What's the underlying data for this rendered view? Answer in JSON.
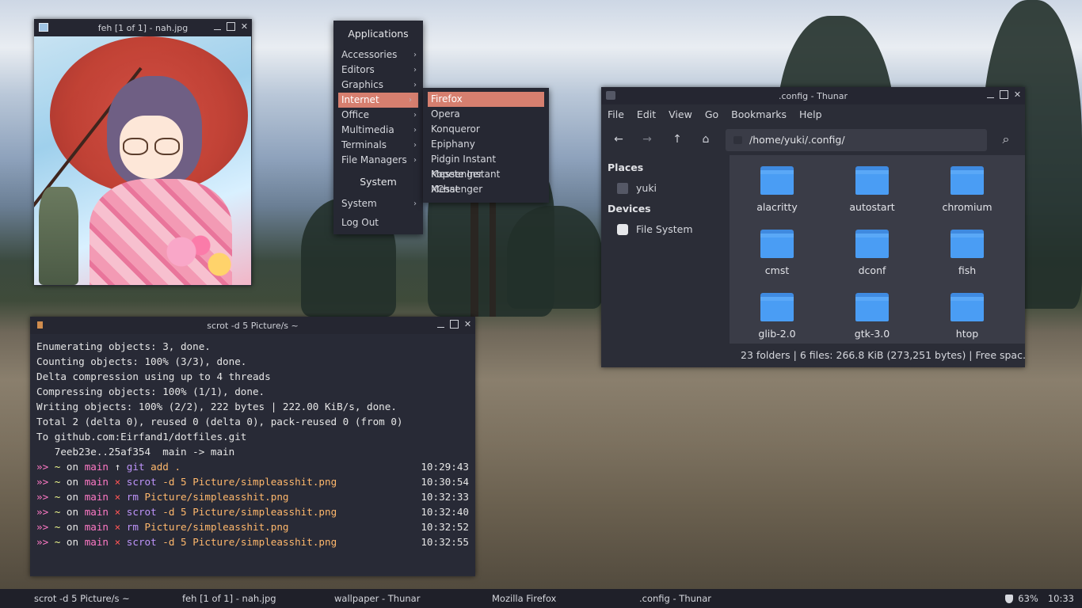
{
  "feh": {
    "title": "feh [1 of 1] - nah.jpg"
  },
  "menu": {
    "applications_heading": "Applications",
    "app_items": [
      {
        "label": "Accessories"
      },
      {
        "label": "Editors"
      },
      {
        "label": "Graphics"
      },
      {
        "label": "Internet"
      },
      {
        "label": "Office"
      },
      {
        "label": "Multimedia"
      },
      {
        "label": "Terminals"
      },
      {
        "label": "File Managers"
      }
    ],
    "system_heading": "System",
    "system_item": "System",
    "logout": "Log Out",
    "submenu_arrow": "›",
    "accent_color": "#d67f6f",
    "internet_items": [
      {
        "label": "Firefox"
      },
      {
        "label": "Opera"
      },
      {
        "label": "Konqueror"
      },
      {
        "label": "Epiphany"
      },
      {
        "label": "Pidgin Instant Messenger"
      },
      {
        "label": "Kopete Instant Messenger"
      },
      {
        "label": "XChat"
      }
    ]
  },
  "thunar": {
    "title": ".config - Thunar",
    "menubar": [
      "File",
      "Edit",
      "View",
      "Go",
      "Bookmarks",
      "Help"
    ],
    "location": "/home/yuki/.config/",
    "sidebar": {
      "places_heading": "Places",
      "home": "yuki",
      "devices_heading": "Devices",
      "filesystem": "File System"
    },
    "folders": [
      "alacritty",
      "autostart",
      "chromium",
      "cmst",
      "dconf",
      "fish",
      "glib-2.0",
      "gtk-3.0",
      "htop"
    ],
    "folder_color": "#4a9df4",
    "status": "23 folders  |  6 files: 266.8 KiB (273,251 bytes)  |  Free spac..."
  },
  "terminal": {
    "title": "scrot -d 5 Picture/s ~",
    "output": [
      "Enumerating objects: 3, done.",
      "Counting objects: 100% (3/3), done.",
      "Delta compression using up to 4 threads",
      "Compressing objects: 100% (1/1), done.",
      "Writing objects: 100% (2/2), 222 bytes | 222.00 KiB/s, done.",
      "Total 2 (delta 0), reused 0 (delta 0), pack-reused 0 (from 0)",
      "To github.com:Eirfand1/dotfiles.git",
      "   7eeb23e..25af354  main -> main"
    ],
    "prompts": [
      {
        "prefix": "»> ",
        "dir": "~",
        "on": " on ",
        "branch": "main",
        "status": " ↑ ",
        "cmd": "git",
        "args": " add .",
        "time": "10:29:43"
      },
      {
        "prefix": "»> ",
        "dir": "~",
        "on": " on ",
        "branch": "main",
        "status": " × ",
        "cmd": "scrot",
        "args": " -d 5 Picture/simpleasshit.png",
        "time": "10:30:54"
      },
      {
        "prefix": "»> ",
        "dir": "~",
        "on": " on ",
        "branch": "main",
        "status": " × ",
        "cmd": "rm",
        "args": " Picture/simpleasshit.png",
        "time": "10:32:33"
      },
      {
        "prefix": "»> ",
        "dir": "~",
        "on": " on ",
        "branch": "main",
        "status": " × ",
        "cmd": "scrot",
        "args": " -d 5 Picture/simpleasshit.png",
        "time": "10:32:40"
      },
      {
        "prefix": "»> ",
        "dir": "~",
        "on": " on ",
        "branch": "main",
        "status": " × ",
        "cmd": "rm",
        "args": " Picture/simpleasshit.png",
        "time": "10:32:52"
      },
      {
        "prefix": "»> ",
        "dir": "~",
        "on": " on ",
        "branch": "main",
        "status": " × ",
        "cmd": "scrot",
        "args": " -d 5 Picture/simpleasshit.png",
        "time": "10:32:55"
      }
    ]
  },
  "taskbar": {
    "tasks": [
      "scrot -d 5 Picture/s ~",
      "feh [1 of 1] - nah.jpg",
      "wallpaper - Thunar",
      "Mozilla Firefox",
      ".config - Thunar"
    ],
    "battery": "63%",
    "clock": "10:33"
  }
}
